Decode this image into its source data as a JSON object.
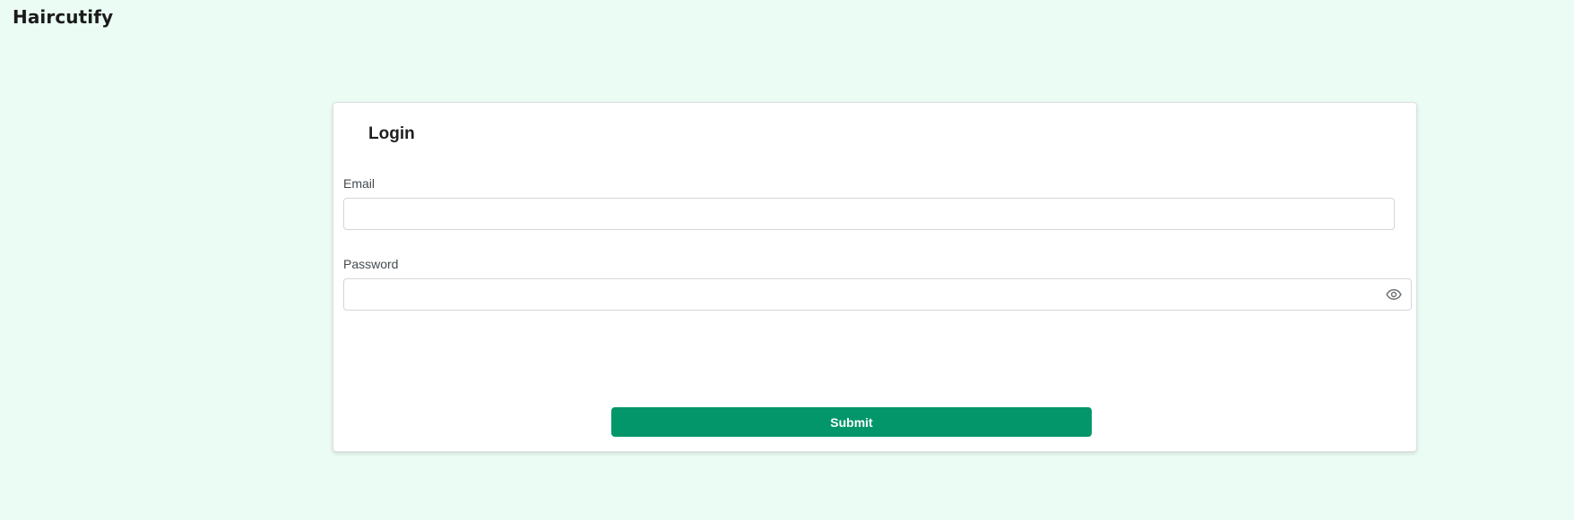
{
  "app": {
    "brand": "Haircutify"
  },
  "login": {
    "title": "Login",
    "email": {
      "label": "Email",
      "value": "",
      "placeholder": ""
    },
    "password": {
      "label": "Password",
      "value": "",
      "placeholder": "",
      "toggle_icon": "eye-icon"
    },
    "submit_label": "Submit"
  },
  "colors": {
    "page_background": "#eafcf4",
    "card_background": "#ffffff",
    "primary_button": "#03966a",
    "brand_text": "#1b1b1b"
  }
}
